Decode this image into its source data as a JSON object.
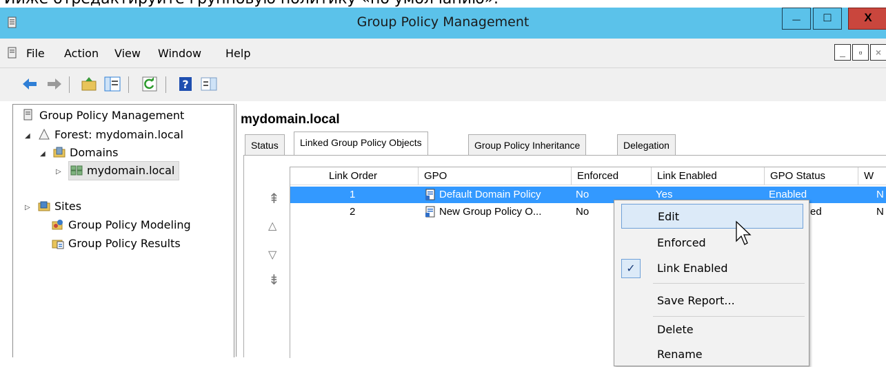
{
  "caption": "Ииже отредактируйте групповую политику «по умолчанию».",
  "window": {
    "title": "Group Policy Management",
    "min_label": "_",
    "max_label": "□",
    "close_label": "X"
  },
  "menubar": {
    "items": [
      "File",
      "Action",
      "View",
      "Window",
      "Help"
    ],
    "mdi_min": "_",
    "mdi_restore": "▫",
    "mdi_close": "×"
  },
  "tree": {
    "root": "Group Policy Management",
    "forest": "Forest: mydomain.local",
    "domains": "Domains",
    "domain": "mydomain.local",
    "sites": "Sites",
    "modeling": "Group Policy Modeling",
    "results": "Group Policy Results"
  },
  "main": {
    "heading": "mydomain.local",
    "tabs": [
      "Status",
      "Linked Group Policy Objects",
      "Group Policy Inheritance",
      "Delegation"
    ],
    "active_tab": "Linked Group Policy Objects",
    "columns": [
      "Link Order",
      "GPO",
      "Enforced",
      "Link Enabled",
      "GPO Status",
      "W"
    ],
    "rows": [
      {
        "order": "1",
        "gpo": "Default Domain Policy",
        "enforced": "No",
        "link_enabled": "Yes",
        "status": "Enabled",
        "w": "N"
      },
      {
        "order": "2",
        "gpo": "New Group Policy O...",
        "enforced": "No",
        "link_enabled": "",
        "status": "ed",
        "w": "N"
      }
    ]
  },
  "context_menu": {
    "items": [
      "Edit",
      "Enforced",
      "Link Enabled",
      "Save Report...",
      "Delete",
      "Rename"
    ],
    "checkmark": "✓"
  },
  "colors": {
    "titlebar": "#5bc2ea",
    "selection": "#3399ff",
    "close_button": "#c9463d"
  }
}
